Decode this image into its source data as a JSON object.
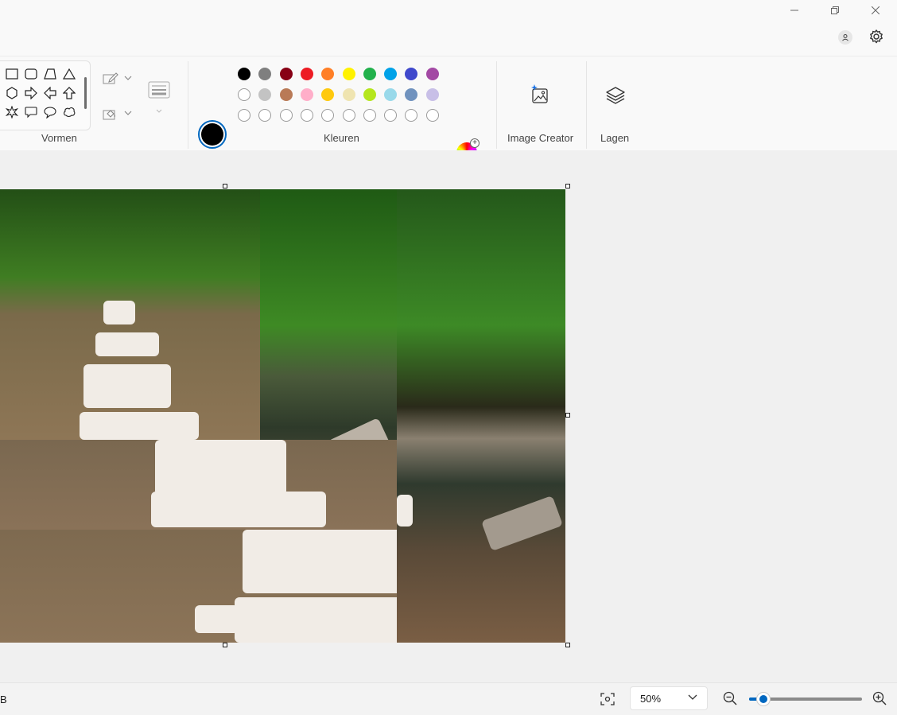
{
  "window": {
    "minimize_icon": "minimize-icon",
    "restore_icon": "restore-icon",
    "close_icon": "close-icon"
  },
  "header": {
    "account_icon": "account-icon",
    "settings_icon": "gear-icon"
  },
  "ribbon": {
    "shapes": {
      "label": "Vormen",
      "items": [
        "rectangle",
        "rounded-rectangle",
        "polygon",
        "triangle",
        "hexagon",
        "arrow-right",
        "arrow-left",
        "arrow-up",
        "star",
        "speech-bubble-rect",
        "speech-bubble-oval",
        "speech-bubble-cloud"
      ]
    },
    "outline_icon": "outline-icon",
    "fill_icon": "fill-icon",
    "size_icon": "line-size-icon",
    "colors": {
      "label": "Kleuren",
      "color1": "#000000",
      "color2": "#ffffff",
      "row1": [
        "#000000",
        "#7f7f7f",
        "#880015",
        "#ed1c24",
        "#ff7f27",
        "#fff200",
        "#22b14c",
        "#00a2e8",
        "#3f48cc",
        "#a349a4"
      ],
      "row2": [
        "#ffffff",
        "#c3c3c3",
        "#b97a57",
        "#ffaec9",
        "#ffc90e",
        "#efe4b0",
        "#b5e61d",
        "#99d9ea",
        "#7092be",
        "#c8bfe7"
      ],
      "custom_count": 10,
      "edit_colors_icon": "color-wheel-icon"
    },
    "image_creator": {
      "label": "Image Creator",
      "icon": "image-creator-icon"
    },
    "layers": {
      "label": "Lagen",
      "icon": "layers-icon"
    }
  },
  "status": {
    "left_text": "B",
    "fit_icon": "fit-to-window-icon",
    "zoom": "50%",
    "zoom_level": 0.1,
    "zoom_out_icon": "zoom-out-icon",
    "zoom_in_icon": "zoom-in-icon"
  }
}
